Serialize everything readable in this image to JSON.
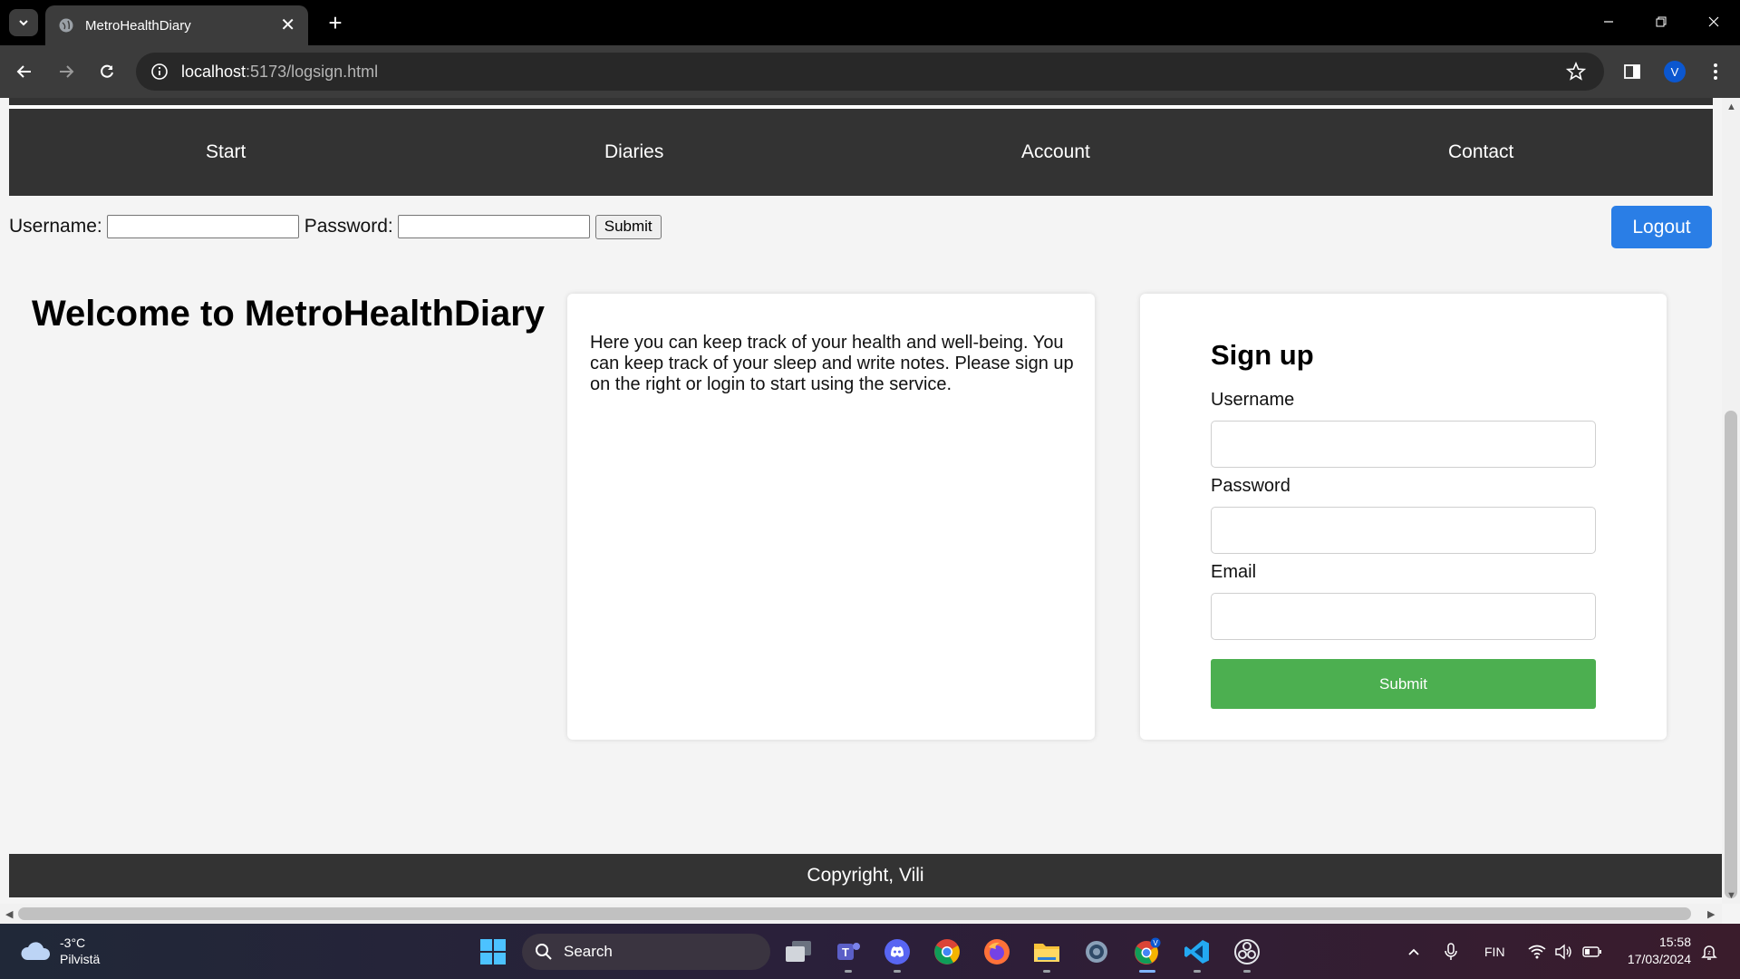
{
  "browser": {
    "tab_title": "MetroHealthDiary",
    "url_host": "localhost",
    "url_path": ":5173/logsign.html",
    "profile_initial": "V"
  },
  "nav": {
    "items": [
      {
        "label": "Start"
      },
      {
        "label": "Diaries"
      },
      {
        "label": "Account"
      },
      {
        "label": "Contact"
      }
    ]
  },
  "login": {
    "username_label": "Username:",
    "password_label": "Password:",
    "submit_label": "Submit",
    "logout_label": "Logout"
  },
  "welcome_title": "Welcome to MetroHealthDiary",
  "info_text": "Here you can keep track of your health and well-being. You can keep track of your sleep and write notes. Please sign up on the right or login to start using the service.",
  "signup": {
    "title": "Sign up",
    "username_label": "Username",
    "password_label": "Password",
    "email_label": "Email",
    "submit_label": "Submit",
    "submit_color": "#4caf50"
  },
  "footer_text": "Copyright, Vili",
  "taskbar": {
    "weather_temp": "-3°C",
    "weather_desc": "Pilvistä",
    "search_label": "Search",
    "language": "FIN",
    "time": "15:58",
    "date": "17/03/2024"
  },
  "colors": {
    "nav_bg": "#333333",
    "logout_bg": "#2a7ee6",
    "page_bg": "#f4f4f4"
  }
}
